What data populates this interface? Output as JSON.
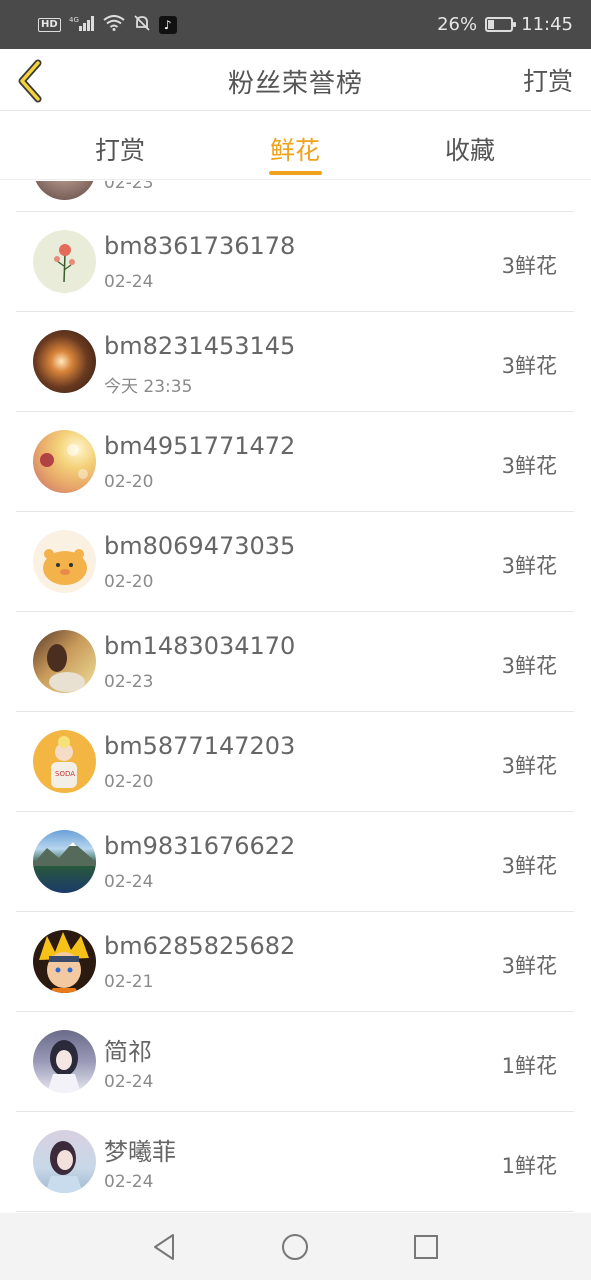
{
  "status_bar": {
    "network_badge": "HD",
    "signal": "4G",
    "battery_percent": "26%",
    "battery_level": 0.26,
    "time": "11:45"
  },
  "header": {
    "title": "粉丝荣誉榜",
    "right_action": "打赏",
    "back_icon": "chevron-left-icon"
  },
  "tabs": [
    {
      "label": "打赏",
      "active": false
    },
    {
      "label": "鲜花",
      "active": true
    },
    {
      "label": "收藏",
      "active": false
    }
  ],
  "accent_color": "#f0a21d",
  "list": {
    "partial_row": {
      "date": "02-23"
    },
    "rows": [
      {
        "name": "bm8361736178",
        "date": "02-24",
        "amount": "3鲜花",
        "avatar": "flower-avatar"
      },
      {
        "name": "bm8231453145",
        "date": "今天 23:35",
        "amount": "3鲜花",
        "avatar": "hands-light-avatar"
      },
      {
        "name": "bm4951771472",
        "date": "02-20",
        "amount": "3鲜花",
        "avatar": "bokeh-avatar"
      },
      {
        "name": "bm8069473035",
        "date": "02-20",
        "amount": "3鲜花",
        "avatar": "bear-cartoon-avatar"
      },
      {
        "name": "bm1483034170",
        "date": "02-23",
        "amount": "3鲜花",
        "avatar": "girl-sunset-avatar"
      },
      {
        "name": "bm5877147203",
        "date": "02-20",
        "amount": "3鲜花",
        "avatar": "soda-girl-avatar"
      },
      {
        "name": "bm9831676622",
        "date": "02-24",
        "amount": "3鲜花",
        "avatar": "mountain-lake-avatar"
      },
      {
        "name": "bm6285825682",
        "date": "02-21",
        "amount": "3鲜花",
        "avatar": "naruto-avatar"
      },
      {
        "name": "简祁",
        "date": "02-24",
        "amount": "1鲜花",
        "avatar": "hanfu-girl-avatar"
      },
      {
        "name": "梦曦菲",
        "date": "02-24",
        "amount": "1鲜花",
        "avatar": "girl-portrait-avatar"
      }
    ]
  },
  "nav_bar": {
    "back": "triangle-back-icon",
    "home": "circle-home-icon",
    "recent": "square-recent-icon"
  }
}
